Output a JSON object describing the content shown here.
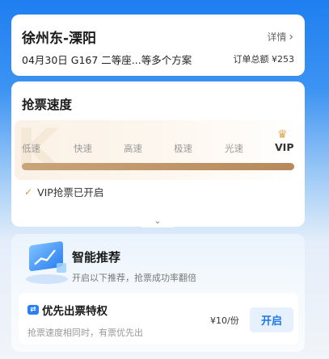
{
  "trip": {
    "route": "徐州东-溧阳",
    "detail_label": "详情",
    "info": "04月30日 G167 二等座...等多个方案",
    "total_label": "订单总额",
    "total_value": "¥253"
  },
  "speed": {
    "title": "抢票速度",
    "levels": [
      "低速",
      "快速",
      "高速",
      "极速",
      "光速",
      "VIP"
    ],
    "progress_fraction": 1.0,
    "status_text": "VIP抢票已开启"
  },
  "recommend": {
    "title": "智能推荐",
    "subtitle": "开启以下推荐，抢票成功率翻倍",
    "priority": {
      "title": "优先出票特权",
      "subtitle": "抢票速度相同时，有票优先出",
      "price": "¥10/份",
      "button": "开启"
    }
  },
  "icons": {
    "detail": "chevron-right-icon",
    "crown": "crown-icon",
    "check": "check-icon",
    "collapse": "chevron-down-icon",
    "recommend": "screen-chart-icon",
    "priority": "ticket-icon"
  },
  "colors": {
    "accent_blue": "#1f78e6",
    "vip_gold": "#b8895a"
  }
}
